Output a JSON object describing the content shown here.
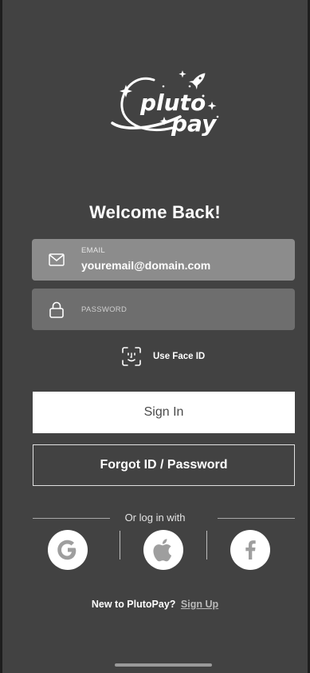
{
  "logo": {
    "line1": "pluto",
    "line2": "pay",
    "icon": "rocket-orbit-logo"
  },
  "heading": "Welcome Back!",
  "email_field": {
    "label": "EMAIL",
    "value": "youremail@domain.com",
    "icon": "envelope-icon"
  },
  "password_field": {
    "label": "PASSWORD",
    "value": "",
    "icon": "lock-icon"
  },
  "face_id": {
    "label": "Use Face ID",
    "icon": "face-id-icon"
  },
  "buttons": {
    "sign_in": "Sign In",
    "forgot": "Forgot ID / Password"
  },
  "divider": {
    "text": "Or log in with"
  },
  "social": [
    {
      "name": "Google",
      "icon": "google-icon"
    },
    {
      "name": "Apple",
      "icon": "apple-icon"
    },
    {
      "name": "Facebook",
      "icon": "facebook-icon"
    }
  ],
  "signup": {
    "prompt": "New to PlutoPay?",
    "link": "Sign Up"
  },
  "colors": {
    "background": "#424242",
    "field_active": "#8c8c8c",
    "field_idle": "#6e6e6e",
    "social_icon": "#9e9e9e"
  }
}
